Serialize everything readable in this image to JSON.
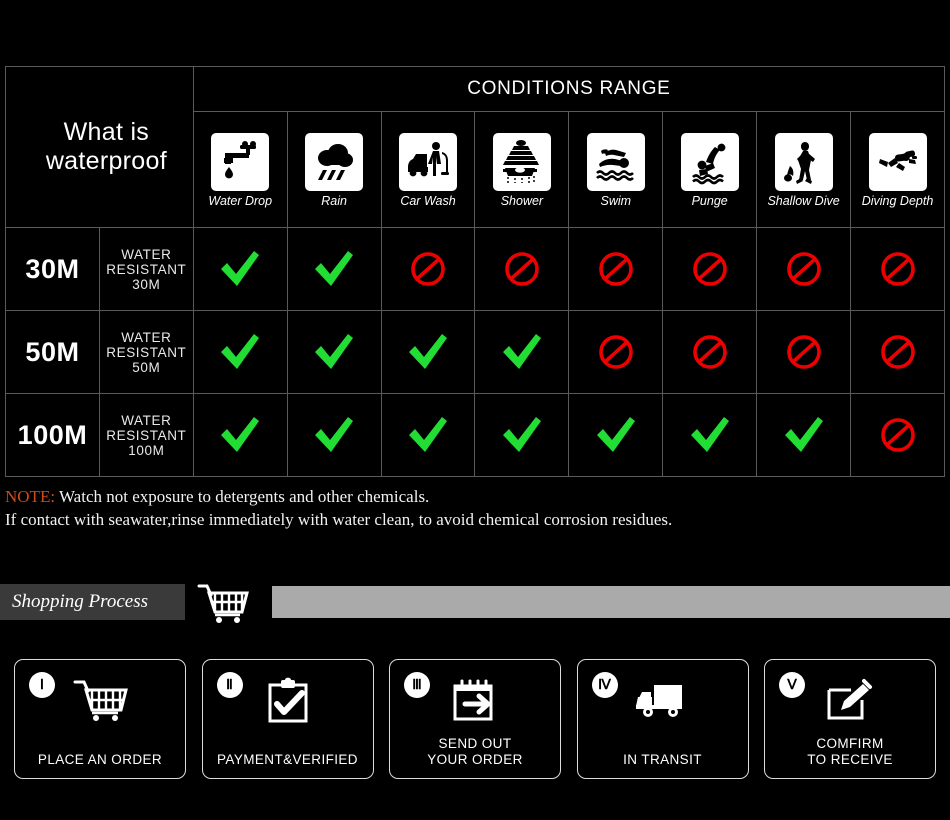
{
  "table": {
    "title": "What is waterproof",
    "conditions_header": "CONDITIONS RANGE",
    "columns": [
      {
        "label": "Water Drop",
        "icon": "faucet-water-drop-icon"
      },
      {
        "label": "Rain",
        "icon": "rain-cloud-icon"
      },
      {
        "label": "Car Wash",
        "icon": "car-wash-icon"
      },
      {
        "label": "Shower",
        "icon": "shower-icon"
      },
      {
        "label": "Swim",
        "icon": "swimmer-icon"
      },
      {
        "label": "Punge",
        "icon": "plunge-dive-icon"
      },
      {
        "label": "Shallow Dive",
        "icon": "shallow-dive-icon"
      },
      {
        "label": "Diving Depth",
        "icon": "scuba-diver-icon"
      }
    ],
    "rows": [
      {
        "depth": "30M",
        "description": "WATER RESISTANT  30M",
        "marks": [
          "yes",
          "yes",
          "no",
          "no",
          "no",
          "no",
          "no",
          "no"
        ]
      },
      {
        "depth": "50M",
        "description": "WATER RESISTANT 50M",
        "marks": [
          "yes",
          "yes",
          "yes",
          "yes",
          "no",
          "no",
          "no",
          "no"
        ]
      },
      {
        "depth": "100M",
        "description": "WATER RESISTANT  100M",
        "marks": [
          "yes",
          "yes",
          "yes",
          "yes",
          "yes",
          "yes",
          "yes",
          "no"
        ]
      }
    ]
  },
  "note": {
    "tag": "NOTE:",
    "line1": "Watch not exposure to detergents and other chemicals.",
    "line2": "If contact with seawater,rinse immediately with water clean, to avoid chemical corrosion residues."
  },
  "shopping_process": {
    "title": "Shopping Process",
    "cart_icon": "shopping-cart-icon",
    "steps": [
      {
        "numeral": "Ⅰ",
        "label": "PLACE AN ORDER",
        "icon": "shopping-cart-icon"
      },
      {
        "numeral": "Ⅱ",
        "label": "PAYMENT&VERIFIED",
        "icon": "clipboard-check-icon"
      },
      {
        "numeral": "Ⅲ",
        "label": "SEND OUT\nYOUR ORDER",
        "icon": "calendar-arrow-icon"
      },
      {
        "numeral": "Ⅳ",
        "label": "IN TRANSIT",
        "icon": "delivery-truck-icon"
      },
      {
        "numeral": "Ⅴ",
        "label": "COMFIRM\nTO RECEIVE",
        "icon": "sign-document-icon"
      }
    ]
  },
  "colors": {
    "check_green": "#22dd33",
    "ban_red": "#ee0000",
    "note_accent": "#cf4a1c",
    "header_bg": "#1d1f23",
    "bar_gray": "#aaaaaa"
  }
}
